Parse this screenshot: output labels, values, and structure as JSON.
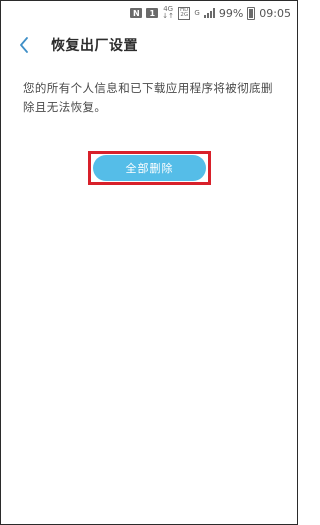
{
  "status_bar": {
    "nfc": "N",
    "sim": "1",
    "network_top": "4G",
    "network_bottom": "↓↑",
    "hd_top": "HD",
    "hd_bottom": "2G",
    "carrier": "G",
    "battery": "99%",
    "time": "09:05"
  },
  "header": {
    "title": "恢复出厂设置"
  },
  "main": {
    "description": "您的所有个人信息和已下载应用程序将被彻底删除且无法恢复。",
    "reset_button_label": "全部删除"
  },
  "colors": {
    "accent": "#55bde8",
    "highlight": "#d8202a",
    "back_icon": "#3f8fc7"
  }
}
